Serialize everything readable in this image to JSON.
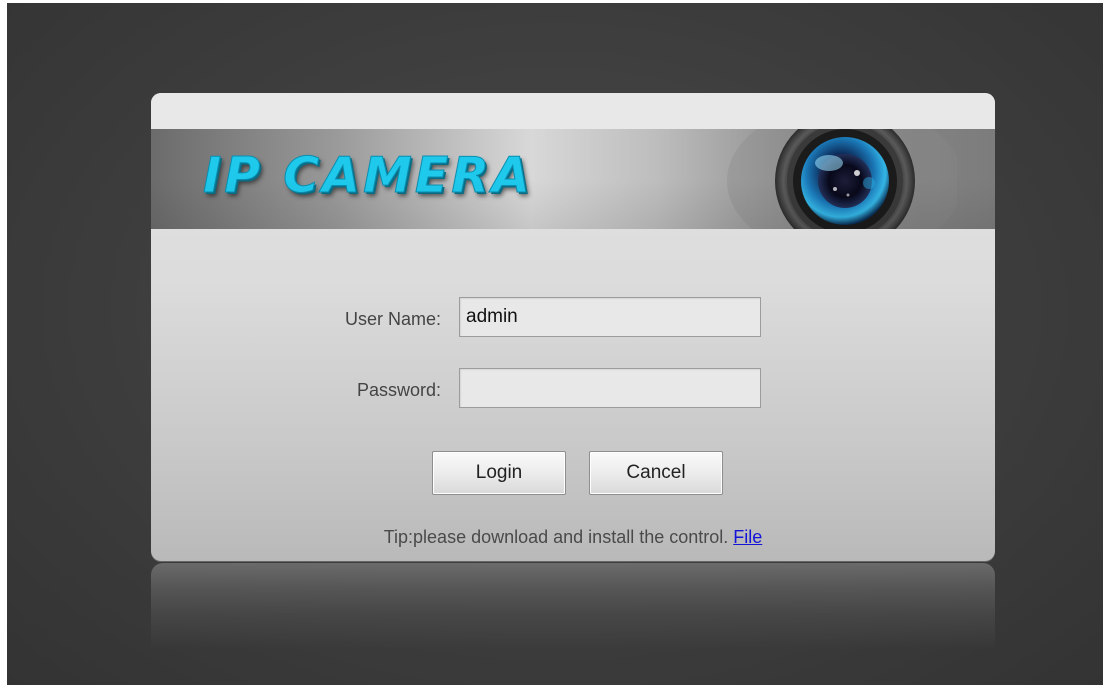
{
  "banner": {
    "title": "IP CAMERA",
    "title_color": "#1ec9ec"
  },
  "login_form": {
    "username_label": "User Name:",
    "username_value": "admin",
    "password_label": "Password:",
    "password_value": "",
    "login_button": "Login",
    "cancel_button": "Cancel"
  },
  "tip": {
    "text": "Tip:please download and install the control. ",
    "link_text": "File",
    "link_color": "#1414d8"
  },
  "icons": {
    "banner_graphic": "camera-lens-icon"
  }
}
